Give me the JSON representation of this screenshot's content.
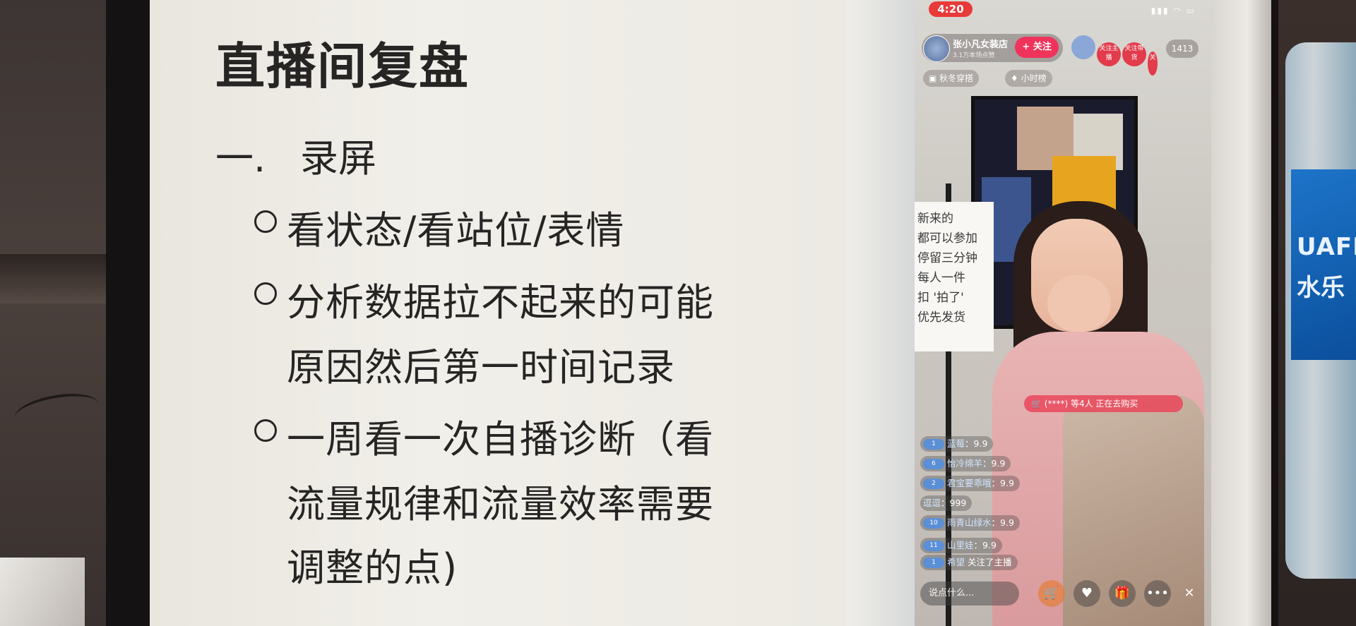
{
  "slide": {
    "title": "直播间复盘",
    "section_number": "一.",
    "section_title": "录屏",
    "lines": [
      "看状态/看站位/表情",
      "分析数据拉不起来的可能",
      "原因然后第一时间记录",
      "一周看一次自播诊断（看",
      "流量规律和流量效率需要",
      "调整的点)"
    ]
  },
  "phone": {
    "time": "4:20",
    "host": {
      "name": "张小凡女装店",
      "sub": "3.1万本场点赞",
      "follow_label": "关注"
    },
    "viewer_badges": [
      "关注主播",
      "关注带货",
      "关"
    ],
    "viewer_count": "1413",
    "tags": [
      "秋冬穿搭",
      "小时榜"
    ],
    "sign_lines": [
      "新来的",
      "都可以参加",
      "停留三分钟",
      "每人一件",
      "扣 '拍了'",
      "优先发货"
    ],
    "buy_banner": "(****) 等4人 正在去购买",
    "comments": [
      {
        "level": "1",
        "name": "蓝莓",
        "text": "9.9"
      },
      {
        "level": "6",
        "name": "怡冷绵羊",
        "text": "9.9"
      },
      {
        "level": "2",
        "name": "君宝要乖哦",
        "text": "9.9"
      },
      {
        "level": "",
        "name": "逗逗",
        "text": "999"
      },
      {
        "level": "10",
        "name": "雨青山绿水",
        "text": "9.9"
      },
      {
        "level": "11",
        "name": "山里娃",
        "text": "9.9"
      },
      {
        "level": "1",
        "name": "希望",
        "text": "关注了主播"
      }
    ],
    "input_placeholder": "说点什么...",
    "bottom_icons": [
      "cart-icon",
      "heart-icon",
      "gift-icon",
      "more-icon",
      "close-icon"
    ]
  },
  "bottle_text": [
    "UAFIN",
    "水乐"
  ]
}
